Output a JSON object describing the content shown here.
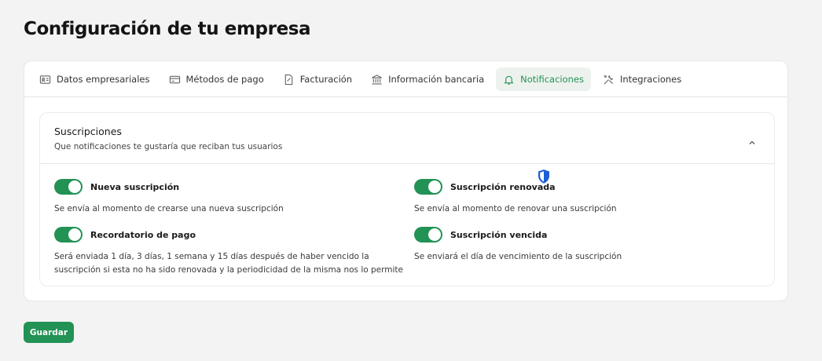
{
  "page": {
    "title": "Configuración de tu empresa"
  },
  "tabs": [
    {
      "label": "Datos empresariales",
      "icon": "id-card-icon"
    },
    {
      "label": "Métodos de pago",
      "icon": "credit-card-icon"
    },
    {
      "label": "Facturación",
      "icon": "invoice-icon"
    },
    {
      "label": "Información bancaria",
      "icon": "bank-icon"
    },
    {
      "label": "Notificaciones",
      "icon": "bell-icon",
      "active": true
    },
    {
      "label": "Integraciones",
      "icon": "tools-icon"
    }
  ],
  "subscriptions": {
    "title": "Suscripciones",
    "subtitle": "Que notificaciones te gustaría que reciban tus usuarios",
    "items": [
      {
        "label": "Nueva suscripción",
        "description": "Se envía al momento de crearse una nueva suscripción",
        "enabled": true
      },
      {
        "label": "Suscripción renovada",
        "description": "Se envía al momento de renovar una suscripción",
        "enabled": true
      },
      {
        "label": "Recordatorio de pago",
        "description": "Será enviada 1 día, 3 días, 1 semana y 15 días después de haber vencido la suscripción si esta no ha sido renovada y la periodicidad de la misma nos lo permite",
        "enabled": true
      },
      {
        "label": "Suscripción vencida",
        "description": "Se enviará el día de vencimiento de la suscripción",
        "enabled": true
      }
    ]
  },
  "actions": {
    "save_label": "Guardar"
  },
  "colors": {
    "accent": "#229255",
    "active_tab_bg": "#eef2ee",
    "shield": "#1d5fd6"
  }
}
